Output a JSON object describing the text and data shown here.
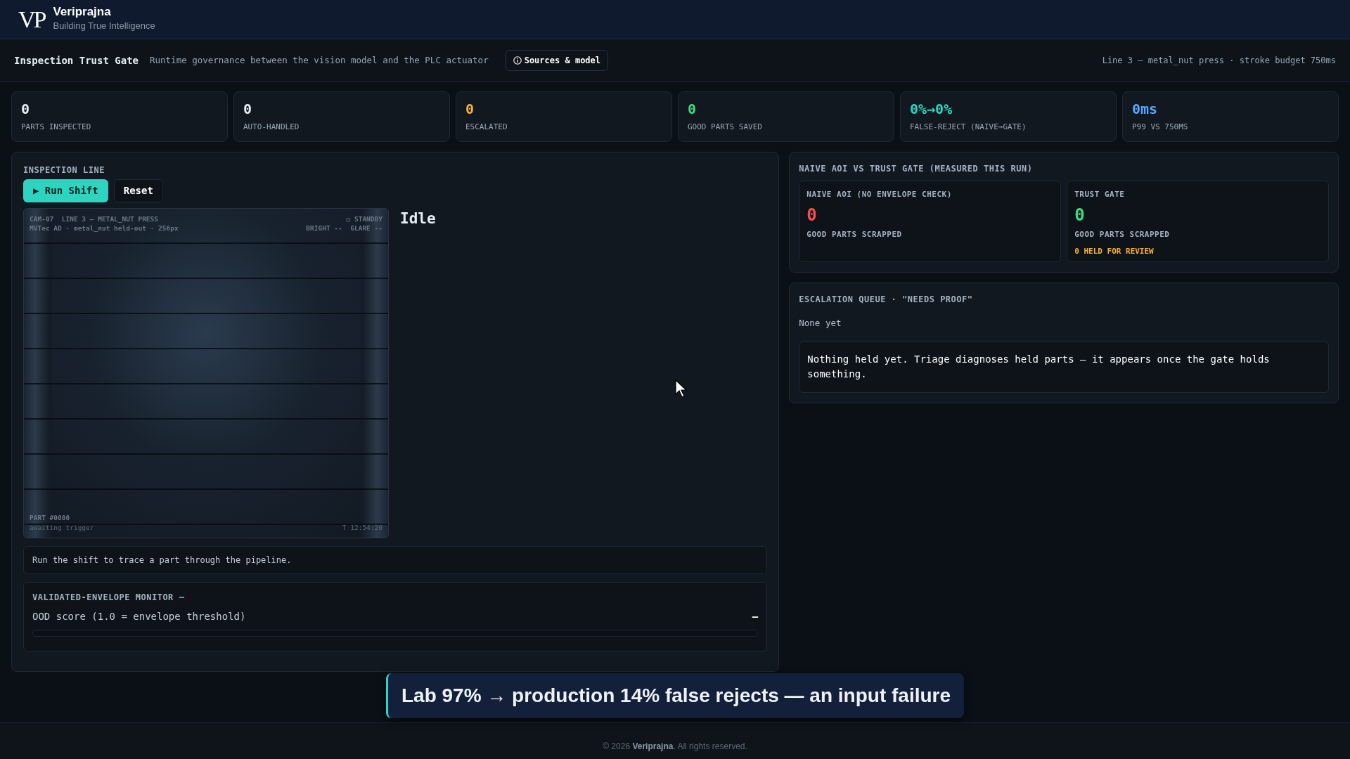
{
  "header": {
    "logo": "VP",
    "brand": "Veriprajna",
    "tagline": "Building True Intelligence"
  },
  "toolbar": {
    "title": "Inspection Trust Gate",
    "subtitle": "Runtime governance between the vision model and the PLC actuator",
    "sources_button": "Sources & model",
    "context": "Line 3 — metal_nut press · stroke budget 750ms"
  },
  "stats": [
    {
      "value": "0",
      "label": "PARTS INSPECTED",
      "color": "#e6edf3"
    },
    {
      "value": "0",
      "label": "AUTO-HANDLED",
      "color": "#e6edf3"
    },
    {
      "value": "0",
      "label": "ESCALATED",
      "color": "#f5b335"
    },
    {
      "value": "0",
      "label": "GOOD PARTS SAVED",
      "color": "#3ddc84"
    },
    {
      "value": "0%→0%",
      "label": "FALSE-REJECT (NAIVE→GATE)",
      "color": "#2dd4bf"
    },
    {
      "value": "0ms",
      "label": "P99 VS 750MS",
      "color": "#58a6ff"
    }
  ],
  "inspection_line": {
    "heading": "INSPECTION LINE",
    "buttons": [
      {
        "label": "▶ Run Shift",
        "kind": "primary"
      },
      {
        "label": "Reset",
        "kind": "secondary"
      }
    ],
    "camera": {
      "id_line": "CAM-07  LINE 3 — METAL_NUT PRESS",
      "source_line": "MVTec AD · metal_nut held-out · 256px",
      "status": "○ STANDBY",
      "readouts": "BRIGHT --  GLARE --",
      "part": "PART #0000",
      "part_state": "awaiting trigger",
      "timestamp": "T 12:54:20"
    },
    "state": "Idle",
    "trace_hint": "Run the shift to trace a part through the pipeline.",
    "monitor": {
      "title": "VALIDATED-ENVELOPE MONITOR",
      "status": "–",
      "metric_label": "OOD score (1.0 = envelope threshold)",
      "reading": "–",
      "level": 0
    }
  },
  "comparison": {
    "title": "NAIVE AOI VS TRUST GATE (MEASURED THIS RUN)",
    "columns": [
      {
        "title": "NAIVE AOI (NO ENVELOPE CHECK)",
        "value": "0",
        "label": "GOOD PARTS SCRAPPED",
        "color": "#f85149"
      },
      {
        "title": "TRUST GATE",
        "value": "0",
        "label": "GOOD PARTS SCRAPPED",
        "note": "0 HELD FOR REVIEW",
        "color": "#3ddc84"
      }
    ]
  },
  "escalation": {
    "title": "ESCALATION QUEUE · \"NEEDS PROOF\"",
    "status": "None yet",
    "message": "Nothing held yet. Triage diagnoses held parts — it appears once the gate holds something."
  },
  "caption": "Lab 97% → production 14% false rejects — an input failure",
  "footer": "© 2026 **Veriprajna**. All rights reserved."
}
